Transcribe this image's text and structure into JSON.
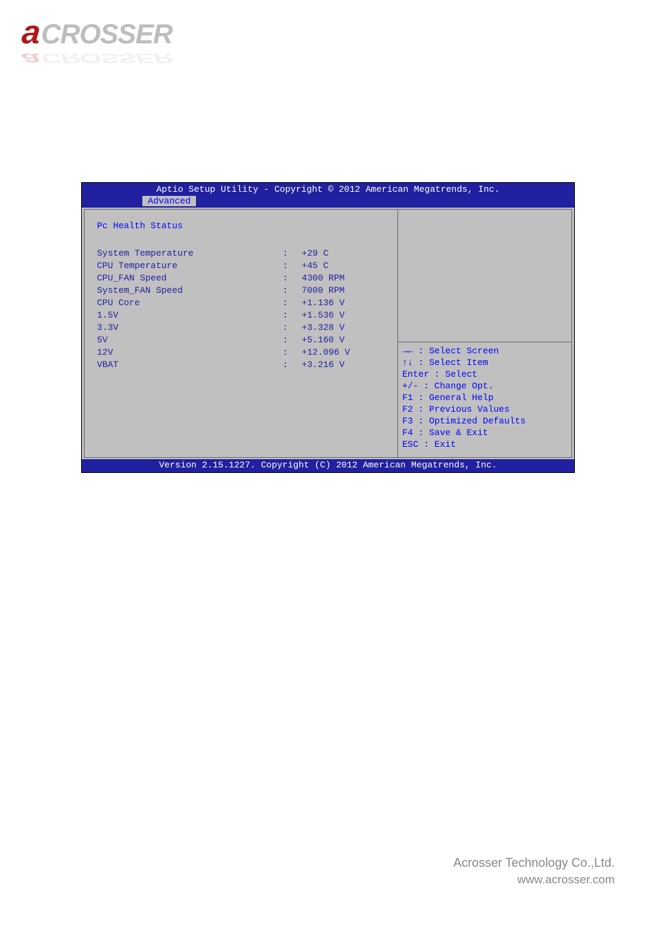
{
  "logo": {
    "initial": "a",
    "rest": "CROSSER"
  },
  "bios": {
    "title": "Aptio Setup Utility - Copyright © 2012 American Megatrends, Inc.",
    "tab": "Advanced",
    "section_title": "Pc Health Status",
    "rows": [
      {
        "label": "System Temperature",
        "value": " +29 C"
      },
      {
        "label": "CPU Temperature",
        "value": " +45 C"
      },
      {
        "label": "CPU_FAN Speed",
        "value": " 4300 RPM"
      },
      {
        "label": "System_FAN Speed",
        "value": " 7000 RPM"
      },
      {
        "label": "CPU Core",
        "value": " +1.136 V"
      },
      {
        "label": "1.5V",
        "value": " +1.536 V"
      },
      {
        "label": "3.3V",
        "value": " +3.328 V"
      },
      {
        "label": "5V",
        "value": " +5.160 V"
      },
      {
        "label": "12V",
        "value": " +12.096 V"
      },
      {
        "label": "VBAT",
        "value": " +3.216 V"
      }
    ],
    "help": [
      "→← : Select Screen",
      "↑↓ : Select Item",
      "Enter : Select",
      "+/- : Change Opt.",
      "F1 : General Help",
      "F2 : Previous Values",
      "F3 : Optimized Defaults",
      "F4 : Save & Exit",
      "ESC : Exit"
    ],
    "version": "Version 2.15.1227. Copyright (C) 2012 American Megatrends, Inc."
  },
  "footer": {
    "company": "Acrosser Technology Co.,Ltd.",
    "site": "www.acrosser.com"
  }
}
